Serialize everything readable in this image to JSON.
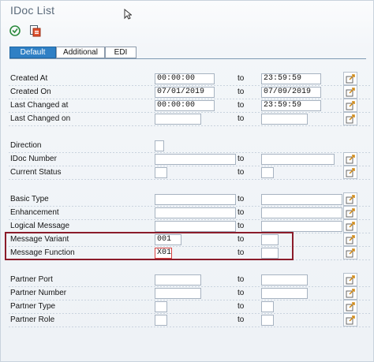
{
  "window": {
    "title": "IDoc List"
  },
  "tabs": [
    {
      "label": "Default",
      "active": true
    },
    {
      "label": "Additional",
      "active": false
    },
    {
      "label": "EDI",
      "active": false
    }
  ],
  "range_word": "to",
  "rows": [
    {
      "label": "Created At",
      "from": "00:00:00",
      "to": "23:59:59"
    },
    {
      "label": "Created On",
      "from": "07/01/2019",
      "to": "07/09/2019"
    },
    {
      "label": "Last Changed at",
      "from": "00:00:00",
      "to": "23:59:59"
    },
    {
      "label": "Last Changed on",
      "from": "",
      "to": ""
    },
    {
      "label": "Direction",
      "from": ""
    },
    {
      "label": "IDoc Number",
      "from": "",
      "to": ""
    },
    {
      "label": "Current Status",
      "from": "",
      "to": ""
    },
    {
      "label": "Basic Type",
      "from": "",
      "to": ""
    },
    {
      "label": "Enhancement",
      "from": "",
      "to": ""
    },
    {
      "label": "Logical Message",
      "from": "",
      "to": ""
    },
    {
      "label": "Message Variant",
      "from": "001",
      "to": ""
    },
    {
      "label": "Message Function",
      "from": "X01",
      "to": ""
    },
    {
      "label": "Partner Port",
      "from": "",
      "to": ""
    },
    {
      "label": "Partner Number",
      "from": "",
      "to": ""
    },
    {
      "label": "Partner Type",
      "from": "",
      "to": ""
    },
    {
      "label": "Partner Role",
      "from": "",
      "to": ""
    }
  ],
  "colors": {
    "accent": "#2f80c5",
    "highlight_box": "#8b1c2a",
    "title_text": "#5a6a7a"
  },
  "icons": [
    "execute-icon",
    "saved-selections-icon",
    "multiple-selection-icon"
  ]
}
